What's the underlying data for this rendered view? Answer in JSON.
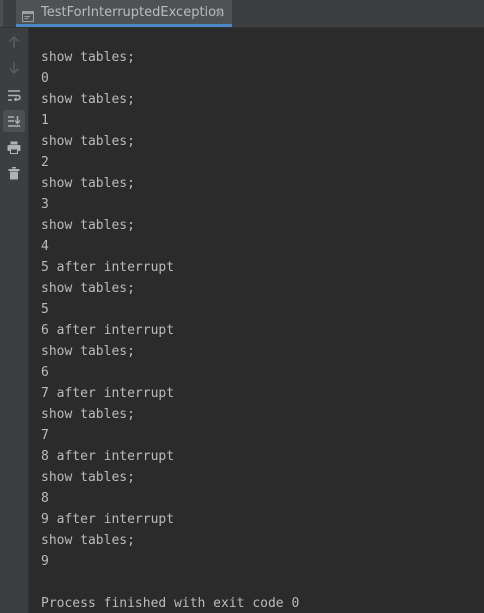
{
  "tab": {
    "title": "TestForInterruptedException",
    "close_glyph": "×",
    "accent_color": "#4a88c7"
  },
  "gutter": {
    "buttons": [
      "up-arrow-icon",
      "down-arrow-icon",
      "soft-wrap-icon",
      "scroll-to-end-icon",
      "print-icon",
      "trash-icon"
    ]
  },
  "console": {
    "lines": [
      "show tables;",
      "0",
      "show tables;",
      "1",
      "show tables;",
      "2",
      "show tables;",
      "3",
      "show tables;",
      "4",
      "5 after interrupt",
      "show tables;",
      "5",
      "6 after interrupt",
      "show tables;",
      "6",
      "7 after interrupt",
      "show tables;",
      "7",
      "8 after interrupt",
      "show tables;",
      "8",
      "9 after interrupt",
      "show tables;",
      "9"
    ],
    "exit_message": "Process finished with exit code 0",
    "text_color": "#bbbbbb",
    "background": "#2b2b2b"
  }
}
